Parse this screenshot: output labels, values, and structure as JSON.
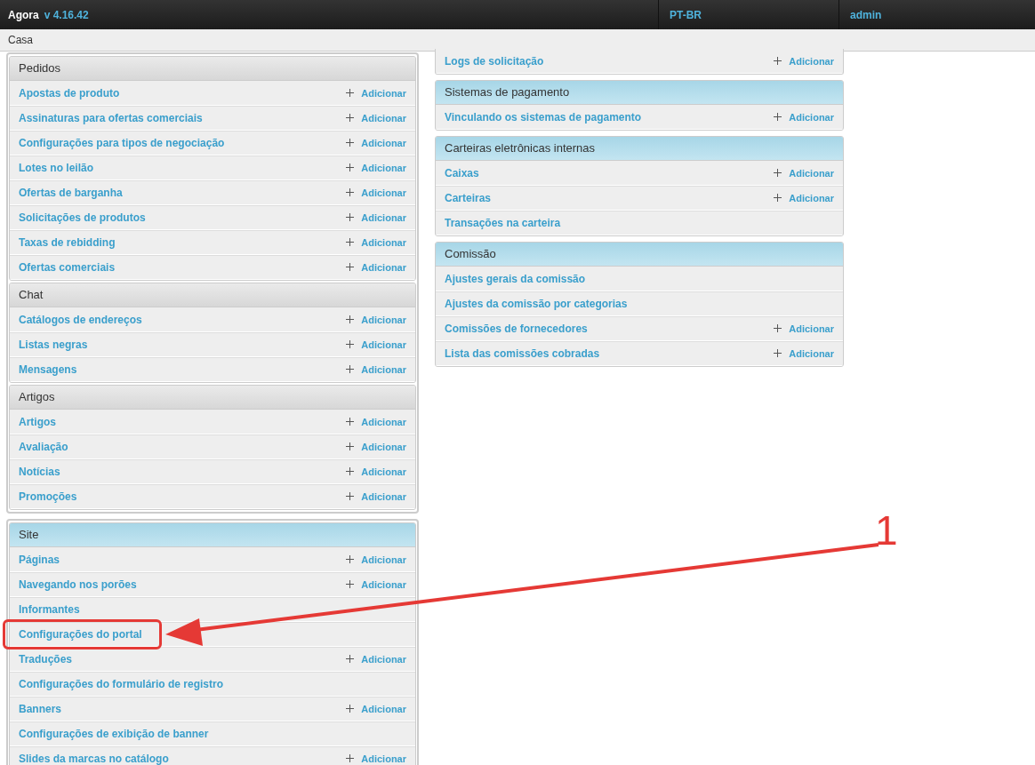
{
  "topbar": {
    "brand": "Agora",
    "version": "v 4.16.42",
    "language": "PT-BR",
    "user": "admin"
  },
  "breadcrumb": "Casa",
  "left_groups": [
    {
      "modules": [
        {
          "title": "Pedidos",
          "highlighted_header": false,
          "items": [
            {
              "label": "Apostas de produto",
              "add": "Adicionar"
            },
            {
              "label": "Assinaturas para ofertas comerciais",
              "add": "Adicionar"
            },
            {
              "label": "Configurações para tipos de negociação",
              "add": "Adicionar"
            },
            {
              "label": "Lotes no leilão",
              "add": "Adicionar"
            },
            {
              "label": "Ofertas de barganha",
              "add": "Adicionar"
            },
            {
              "label": "Solicitações de produtos",
              "add": "Adicionar"
            },
            {
              "label": "Taxas de rebidding",
              "add": "Adicionar"
            },
            {
              "label": "Ofertas comerciais",
              "add": "Adicionar"
            }
          ]
        },
        {
          "title": "Chat",
          "highlighted_header": false,
          "items": [
            {
              "label": "Catálogos de endereços",
              "add": "Adicionar"
            },
            {
              "label": "Listas negras",
              "add": "Adicionar"
            },
            {
              "label": "Mensagens",
              "add": "Adicionar"
            }
          ]
        },
        {
          "title": "Artigos",
          "highlighted_header": false,
          "items": [
            {
              "label": "Artigos",
              "add": "Adicionar"
            },
            {
              "label": "Avaliação",
              "add": "Adicionar"
            },
            {
              "label": "Notícias",
              "add": "Adicionar"
            },
            {
              "label": "Promoções",
              "add": "Adicionar"
            }
          ]
        }
      ]
    },
    {
      "modules": [
        {
          "title": "Site",
          "highlighted_header": true,
          "items": [
            {
              "label": "Páginas",
              "add": "Adicionar"
            },
            {
              "label": "Navegando nos porões",
              "add": "Adicionar"
            },
            {
              "label": "Informantes"
            },
            {
              "label": "Configurações do portal",
              "marked": true
            },
            {
              "label": "Traduções",
              "add": "Adicionar"
            },
            {
              "label": "Configurações do formulário de registro"
            },
            {
              "label": "Banners",
              "add": "Adicionar"
            },
            {
              "label": "Configurações de exibição de banner"
            },
            {
              "label": "Slides da marcas no catálogo",
              "add": "Adicionar"
            }
          ]
        }
      ]
    }
  ],
  "right_modules": [
    {
      "items": [
        {
          "label": "Logs de solicitação",
          "add": "Adicionar"
        }
      ]
    },
    {
      "title": "Sistemas de pagamento",
      "highlighted_header": true,
      "items": [
        {
          "label": "Vinculando os sistemas de pagamento",
          "add": "Adicionar"
        }
      ]
    },
    {
      "title": "Carteiras eletrônicas internas",
      "highlighted_header": true,
      "items": [
        {
          "label": "Caixas",
          "add": "Adicionar"
        },
        {
          "label": "Carteiras",
          "add": "Adicionar"
        },
        {
          "label": "Transações na carteira"
        }
      ]
    },
    {
      "title": "Comissão",
      "highlighted_header": true,
      "items": [
        {
          "label": "Ajustes gerais da comissão"
        },
        {
          "label": "Ajustes da comissão por categorias"
        },
        {
          "label": "Comissões de fornecedores",
          "add": "Adicionar"
        },
        {
          "label": "Lista das comissões cobradas",
          "add": "Adicionar"
        }
      ]
    }
  ],
  "annotation": {
    "label": "1"
  }
}
